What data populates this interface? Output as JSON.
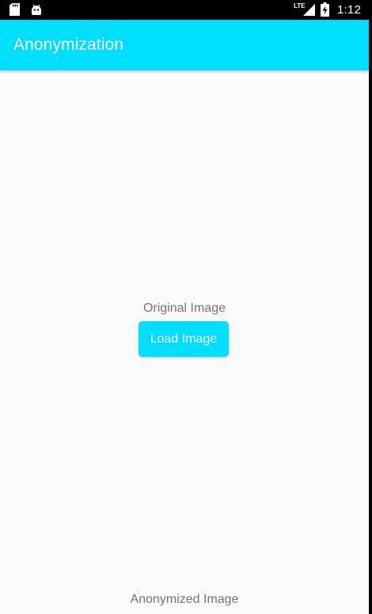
{
  "status_bar": {
    "time": "1:12",
    "network_label": "LTE",
    "left_icons": [
      "sd-card-icon",
      "android-debug-icon"
    ],
    "right_icons": [
      "signal-icon",
      "battery-charging-icon"
    ]
  },
  "app_bar": {
    "title": "Anonymization"
  },
  "main": {
    "original_label": "Original Image",
    "load_button_label": "Load Image",
    "anonymized_label": "Anonymized Image"
  },
  "colors": {
    "accent": "#00ddff",
    "background": "#fafafa",
    "label_text": "#757575",
    "status_bar": "#000000"
  }
}
